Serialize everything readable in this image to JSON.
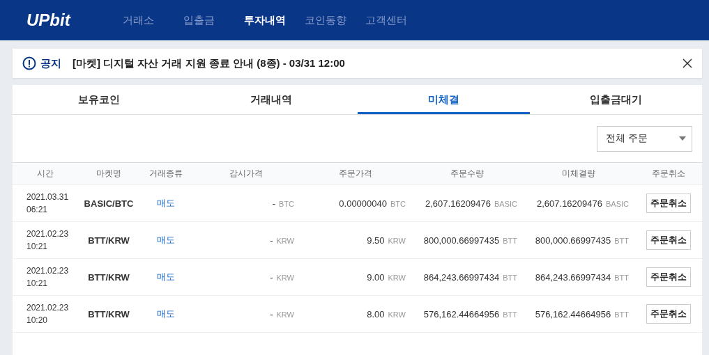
{
  "header": {
    "logo": "UPbit",
    "nav": [
      {
        "label": "거래소",
        "selected": false
      },
      {
        "label": "입출금",
        "selected": false
      },
      {
        "label": "투자내역",
        "selected": true
      },
      {
        "label": "코인동향",
        "selected": false
      },
      {
        "label": "고객센터",
        "selected": false
      }
    ]
  },
  "notice": {
    "label": "공지",
    "text": "[마켓] 디지털 자산 거래 지원 종료 안내 (8종) - 03/31 12:00"
  },
  "tabs": [
    {
      "label": "보유코인",
      "selected": false
    },
    {
      "label": "거래내역",
      "selected": false
    },
    {
      "label": "미체결",
      "selected": true
    },
    {
      "label": "입출금대기",
      "selected": false
    }
  ],
  "filter": {
    "value": "전체 주문"
  },
  "table": {
    "columns": [
      "시간",
      "마켓명",
      "거래종류",
      "감시가격",
      "주문가격",
      "주문수량",
      "미체결량",
      "주문취소"
    ],
    "rows": [
      {
        "date": "2021.03.31",
        "time": "06:21",
        "market": "BASIC/BTC",
        "side": "매도",
        "watch_price": {
          "value": "-",
          "unit": "BTC"
        },
        "price": {
          "value": "0.00000040",
          "unit": "BTC"
        },
        "quantity": {
          "value": "2,607.16209476",
          "unit": "BASIC"
        },
        "remaining": {
          "value": "2,607.16209476",
          "unit": "BASIC"
        },
        "action": "주문취소"
      },
      {
        "date": "2021.02.23",
        "time": "10:21",
        "market": "BTT/KRW",
        "side": "매도",
        "watch_price": {
          "value": "-",
          "unit": "KRW"
        },
        "price": {
          "value": "9.50",
          "unit": "KRW"
        },
        "quantity": {
          "value": "800,000.66997435",
          "unit": "BTT"
        },
        "remaining": {
          "value": "800,000.66997435",
          "unit": "BTT"
        },
        "action": "주문취소"
      },
      {
        "date": "2021.02.23",
        "time": "10:21",
        "market": "BTT/KRW",
        "side": "매도",
        "watch_price": {
          "value": "-",
          "unit": "KRW"
        },
        "price": {
          "value": "9.00",
          "unit": "KRW"
        },
        "quantity": {
          "value": "864,243.66997434",
          "unit": "BTT"
        },
        "remaining": {
          "value": "864,243.66997434",
          "unit": "BTT"
        },
        "action": "주문취소"
      },
      {
        "date": "2021.02.23",
        "time": "10:20",
        "market": "BTT/KRW",
        "side": "매도",
        "watch_price": {
          "value": "-",
          "unit": "KRW"
        },
        "price": {
          "value": "8.00",
          "unit": "KRW"
        },
        "quantity": {
          "value": "576,162.44664956",
          "unit": "BTT"
        },
        "remaining": {
          "value": "576,162.44664956",
          "unit": "BTT"
        },
        "action": "주문취소"
      }
    ]
  }
}
